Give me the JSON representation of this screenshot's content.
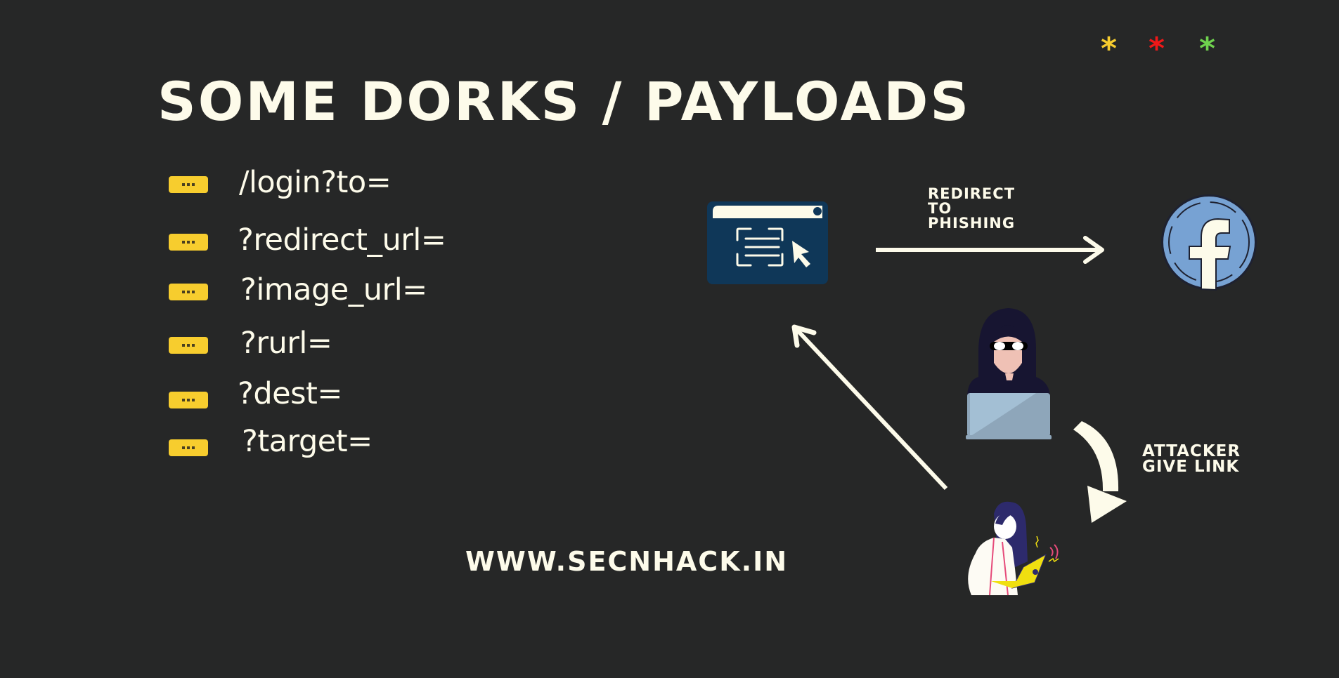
{
  "decorations": {
    "asterisks": [
      {
        "glyph": "*",
        "color": "#f7cd2e"
      },
      {
        "glyph": "*",
        "color": "#f01818"
      },
      {
        "glyph": "*",
        "color": "#6fd24e"
      }
    ]
  },
  "title": "SOME DORKS / PAYLOADS",
  "payloads": [
    {
      "text": "/login?to=",
      "badge_icon": "more-dots-icon"
    },
    {
      "text": "?redirect_url=",
      "badge_icon": "more-dots-icon"
    },
    {
      "text": "?image_url=",
      "badge_icon": "more-dots-icon"
    },
    {
      "text": "?rurl=",
      "badge_icon": "more-dots-icon"
    },
    {
      "text": "?dest=",
      "badge_icon": "more-dots-icon"
    },
    {
      "text": "?target=",
      "badge_icon": "more-dots-icon"
    }
  ],
  "diagram": {
    "redirect_label": [
      "REDIRECT",
      "TO",
      "PHISHING"
    ],
    "attacker_label": [
      "ATTACKER",
      "GIVE LINK"
    ],
    "nodes": {
      "website": "browser-window-icon",
      "target_site": "facebook-icon",
      "attacker": "hacker-illustration",
      "victim": "victim-with-laptop-illustration"
    }
  },
  "footer": {
    "site_url": "WWW.SECNHACK.IN"
  },
  "colors": {
    "background": "#262727",
    "text": "#fdfbea",
    "badge": "#f7cd2e",
    "browser_icon": "#0f3758",
    "facebook_blue": "#77a2d3"
  }
}
